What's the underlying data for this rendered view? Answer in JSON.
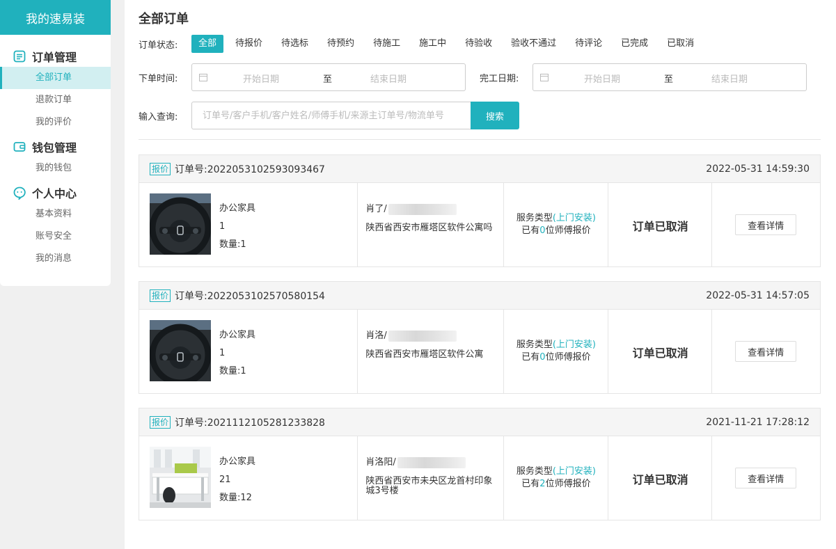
{
  "sidebar": {
    "title": "我的速易装",
    "sections": [
      {
        "title": "订单管理",
        "items": [
          "全部订单",
          "退款订单",
          "我的评价"
        ]
      },
      {
        "title": "钱包管理",
        "items": [
          "我的钱包"
        ]
      },
      {
        "title": "个人中心",
        "items": [
          "基本资料",
          "账号安全",
          "我的消息"
        ]
      }
    ],
    "active_item": "全部订单"
  },
  "main": {
    "title": "全部订单",
    "status_label": "订单状态:",
    "status_tabs": [
      "全部",
      "待报价",
      "待选标",
      "待预约",
      "待施工",
      "施工中",
      "待验收",
      "验收不通过",
      "待评论",
      "已完成",
      "已取消"
    ],
    "active_status": "全部",
    "order_date_label": "下单时间:",
    "finish_date_label": "完工日期:",
    "start_placeholder": "开始日期",
    "date_sep": "至",
    "end_placeholder": "结束日期",
    "search_label": "输入查询:",
    "search_placeholder": "订单号/客户手机/客户姓名/师傅手机/来源主订单号/物流单号",
    "search_button": "搜索"
  },
  "orders": [
    {
      "tag": "报价",
      "order_no": "订单号:2022053102593093467",
      "time": "2022-05-31 14:59:30",
      "product": "办公家具",
      "qty_line": "1",
      "count": "数量:1",
      "customer": "肖了/",
      "address": "陕西省西安市雁塔区软件公寓吗",
      "service_prefix": "服务类型",
      "service_type": "(上门安装)",
      "quote_prefix": "已有",
      "quote_count": "0",
      "quote_suffix": "位师傅报价",
      "status": "订单已取消",
      "detail_button": "查看详情"
    },
    {
      "tag": "报价",
      "order_no": "订单号:2022053102570580154",
      "time": "2022-05-31 14:57:05",
      "product": "办公家具",
      "qty_line": "1",
      "count": "数量:1",
      "customer": "肖洛/",
      "address": "陕西省西安市雁塔区软件公寓",
      "service_prefix": "服务类型",
      "service_type": "(上门安装)",
      "quote_prefix": "已有",
      "quote_count": "0",
      "quote_suffix": "位师傅报价",
      "status": "订单已取消",
      "detail_button": "查看详情"
    },
    {
      "tag": "报价",
      "order_no": "订单号:2021112105281233828",
      "time": "2021-11-21 17:28:12",
      "product": "办公家具",
      "qty_line": "21",
      "count": "数量:12",
      "customer": "肖洛阳/",
      "address": "陕西省西安市未央区龙首村印象城3号楼",
      "service_prefix": "服务类型",
      "service_type": "(上门安装)",
      "quote_prefix": "已有",
      "quote_count": "2",
      "quote_suffix": "位师傅报价",
      "status": "订单已取消",
      "detail_button": "查看详情"
    }
  ],
  "colors": {
    "accent": "#20b1bd",
    "active_bg": "#d2eff1"
  }
}
